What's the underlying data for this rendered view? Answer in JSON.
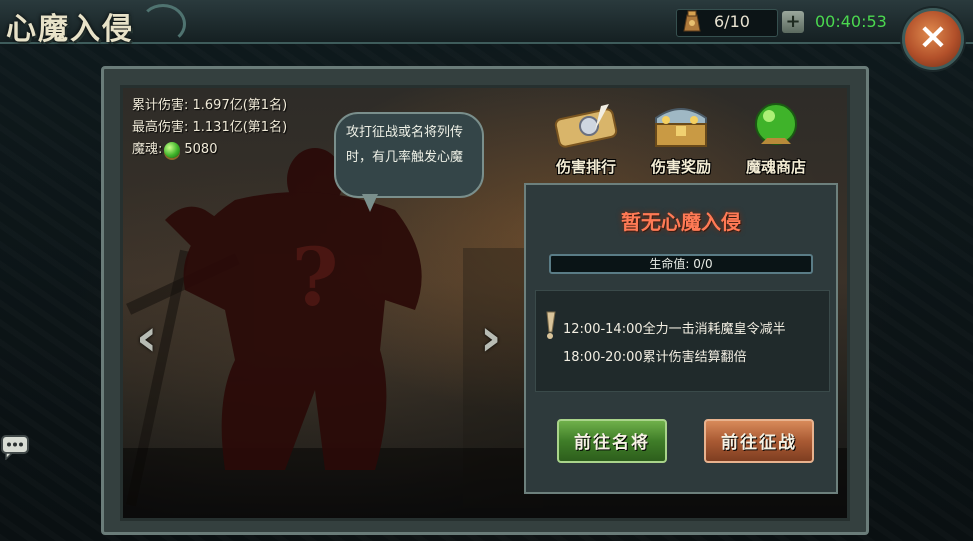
{
  "header": {
    "title": "心魔入侵",
    "resource_count": "6/10",
    "plus_label": "+",
    "timer": "00:40:53",
    "close_label": "×"
  },
  "stats": {
    "total_damage": "累计伤害: 1.697亿(第1名)",
    "max_damage": "最高伤害: 1.131亿(第1名)",
    "soul_label": "魔魂:",
    "soul_value": "5080"
  },
  "bubble": {
    "line1": "攻打征战或名将列传",
    "line2": "时，有几率触发心魔"
  },
  "nav_arrows": {
    "left": "‹",
    "right": "›"
  },
  "top_icons": [
    {
      "label": "伤害排行",
      "icon": "scroll-quill-icon"
    },
    {
      "label": "伤害奖励",
      "icon": "treasure-chest-icon"
    },
    {
      "label": "魔魂商店",
      "icon": "green-orb-icon"
    }
  ],
  "panel": {
    "title": "暂无心魔入侵",
    "hp_label": "生命值: 0/0",
    "hp_fraction": 0,
    "info_lines": [
      "12:00-14:00全力一击消耗魔皇令减半",
      "18:00-20:00累计伤害结算翻倍"
    ],
    "btn_generals": "前往名将",
    "btn_campaign": "前往征战"
  },
  "colors": {
    "panel_title": "#ff7a55",
    "timer": "#4bd84f",
    "btn_green": "#3f7d28",
    "btn_orange": "#a95a33"
  }
}
